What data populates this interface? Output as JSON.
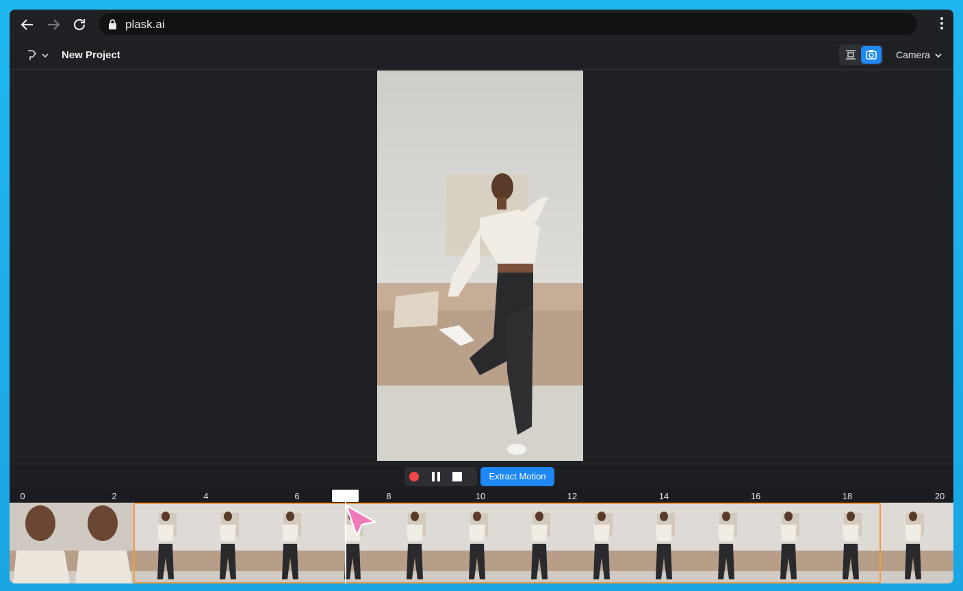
{
  "browser": {
    "url": "plask.ai",
    "icons": [
      "back-arrow-icon",
      "forward-arrow-icon",
      "reload-icon",
      "lock-icon",
      "menu-dots-icon"
    ]
  },
  "app": {
    "project_title": "New Project",
    "camera_label": "Camera",
    "accent": "#1e88f5",
    "selection_color": "#f39a3c"
  },
  "controls": {
    "extract_label": "Extract Motion",
    "record_color": "#f04848"
  },
  "timeline": {
    "ticks": [
      "0",
      "2",
      "4",
      "6",
      "8",
      "10",
      "12",
      "14",
      "16",
      "18",
      "20"
    ],
    "playhead_seconds": 7.1,
    "selection_start_seconds": 2.5,
    "selection_end_seconds": 18.7
  }
}
